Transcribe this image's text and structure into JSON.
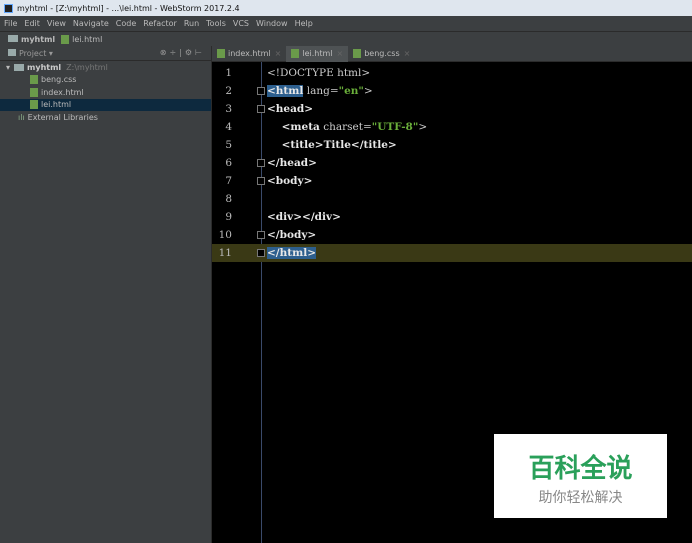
{
  "window": {
    "title": "myhtml - [Z:\\myhtml] - ...\\lei.html - WebStorm 2017.2.4"
  },
  "menu": [
    "File",
    "Edit",
    "View",
    "Navigate",
    "Code",
    "Refactor",
    "Run",
    "Tools",
    "VCS",
    "Window",
    "Help"
  ],
  "navbar": {
    "project": "myhtml",
    "file": "lei.html"
  },
  "sidebar": {
    "header": "Project",
    "root": "myhtml",
    "root_path": "Z:\\myhtml",
    "files": [
      "beng.css",
      "index.html",
      "lei.html"
    ],
    "external": "External Libraries"
  },
  "tabs": [
    "index.html",
    "lei.html",
    "beng.css"
  ],
  "editor": {
    "lines": [
      {
        "n": "1",
        "t": "<!DOCTYPE html>"
      },
      {
        "n": "2",
        "a": "<html",
        "b": " lang=",
        "c": "\"en\"",
        "d": ">"
      },
      {
        "n": "3",
        "t": "<head>"
      },
      {
        "n": "4",
        "a": "    <meta",
        "b": " charset=",
        "c": "\"UTF-8\"",
        "d": ">"
      },
      {
        "n": "5",
        "t": "    <title>Title</title>"
      },
      {
        "n": "6",
        "t": "</head>"
      },
      {
        "n": "7",
        "t": "<body>"
      },
      {
        "n": "8",
        "t": ""
      },
      {
        "n": "9",
        "t": "<div></div>"
      },
      {
        "n": "10",
        "t": "</body>"
      },
      {
        "n": "11",
        "t": "</html>"
      }
    ]
  },
  "watermark": {
    "title": "百科全说",
    "subtitle": "助你轻松解决"
  }
}
